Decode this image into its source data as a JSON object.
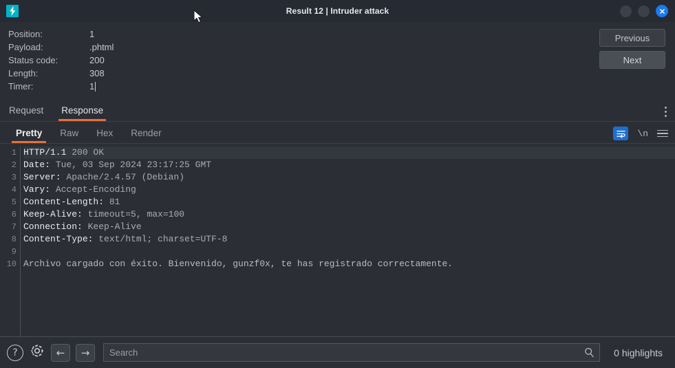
{
  "window": {
    "title": "Result 12 | Intruder attack",
    "logo_icon": "lightning-bolt-icon",
    "logo_glyph": "⚡",
    "accent_color": "#e8703a",
    "logo_color": "#00b4c8",
    "close_color": "#1d7aeb",
    "controls": {
      "minimize_label": "",
      "maximize_label": "",
      "close_label": "✕"
    }
  },
  "info": {
    "rows": [
      {
        "label": "Position:",
        "value": "1"
      },
      {
        "label": "Payload:",
        "value": ".phtml"
      },
      {
        "label": "Status code:",
        "value": "200"
      },
      {
        "label": "Length:",
        "value": "308"
      },
      {
        "label": "Timer:",
        "value": "1"
      }
    ],
    "previous_label": "Previous",
    "next_label": "Next"
  },
  "main_tabs": [
    {
      "label": "Request",
      "active": false
    },
    {
      "label": "Response",
      "active": true
    }
  ],
  "sub_tabs": [
    {
      "label": "Pretty",
      "active": true
    },
    {
      "label": "Raw",
      "active": false
    },
    {
      "label": "Hex",
      "active": false
    },
    {
      "label": "Render",
      "active": false
    }
  ],
  "sub_tools": {
    "wrap_icon": "word-wrap-icon",
    "newline_label": "\\n",
    "menu_icon": "hamburger-menu-icon",
    "kebab_icon": "more-options-icon"
  },
  "editor": {
    "lines": [
      {
        "n": "1",
        "name": "HTTP/1.1",
        "value": " 200 OK",
        "current": true,
        "kind": "status"
      },
      {
        "n": "2",
        "name": "Date:",
        "value": " Tue, 03 Sep 2024 23:17:25 GMT",
        "current": false,
        "kind": "header"
      },
      {
        "n": "3",
        "name": "Server:",
        "value": " Apache/2.4.57 (Debian)",
        "current": false,
        "kind": "header"
      },
      {
        "n": "4",
        "name": "Vary:",
        "value": " Accept-Encoding",
        "current": false,
        "kind": "header"
      },
      {
        "n": "5",
        "name": "Content-Length:",
        "value": " 81",
        "current": false,
        "kind": "header"
      },
      {
        "n": "6",
        "name": "Keep-Alive:",
        "value": " timeout=5, max=100",
        "current": false,
        "kind": "header"
      },
      {
        "n": "7",
        "name": "Connection:",
        "value": " Keep-Alive",
        "current": false,
        "kind": "header"
      },
      {
        "n": "8",
        "name": "Content-Type:",
        "value": " text/html; charset=UTF-8",
        "current": false,
        "kind": "header"
      },
      {
        "n": "9",
        "name": "",
        "value": "",
        "current": false,
        "kind": "blank"
      },
      {
        "n": "10",
        "name": "",
        "value": "Archivo cargado con éxito. Bienvenido, gunzf0x, te has registrado correctamente.",
        "current": false,
        "kind": "body"
      }
    ]
  },
  "bottom": {
    "help_icon": "help-icon",
    "help_glyph": "?",
    "settings_icon": "gear-icon",
    "back_icon": "arrow-left-icon",
    "back_glyph": "←",
    "forward_icon": "arrow-right-icon",
    "forward_glyph": "→",
    "search_placeholder": "Search",
    "search_value": "",
    "search_icon": "magnifier-icon",
    "highlights_label": "0 highlights"
  }
}
